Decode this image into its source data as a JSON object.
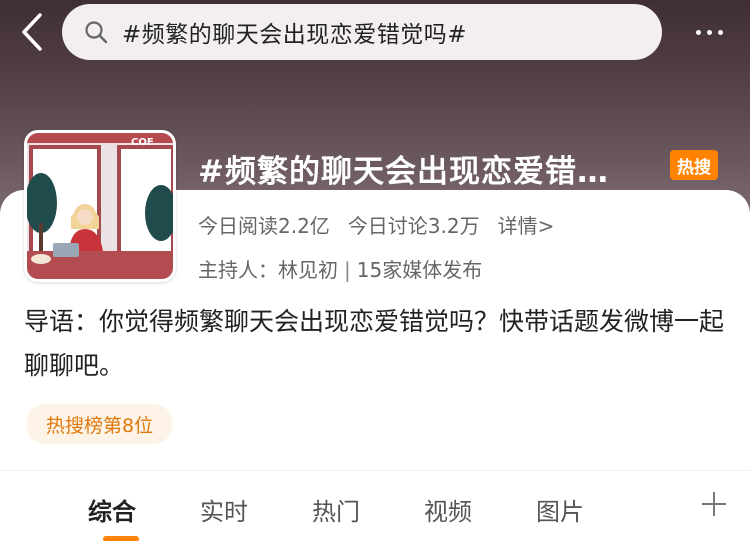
{
  "search": {
    "query": "#频繁的聊天会出现恋爱错觉吗#"
  },
  "topic": {
    "title": "#频繁的聊天会出现恋爱错…",
    "badge": "热搜",
    "cover_text": "COF",
    "stats": {
      "reads": "今日阅读2.2亿",
      "discussions": "今日讨论3.2万",
      "details": "详情>"
    },
    "host": {
      "label": "主持人：林见初",
      "separator": "|",
      "media": "15家媒体发布"
    }
  },
  "guide": {
    "text": "导语：你觉得频繁聊天会出现恋爱错觉吗？快带话题发微博一起聊聊吧。"
  },
  "rank": {
    "label": "热搜榜第8位"
  },
  "tabs": [
    {
      "label": "综合"
    },
    {
      "label": "实时"
    },
    {
      "label": "热门"
    },
    {
      "label": "视频"
    },
    {
      "label": "图片"
    }
  ],
  "icons": [
    "back-arrow-icon",
    "search-icon",
    "more-icon",
    "plus-icon"
  ],
  "colors": {
    "accent": "#ff8200",
    "rank_bg": "#fdf3e6",
    "rank_text": "#e0780c",
    "header_bg": "#5a464c"
  }
}
